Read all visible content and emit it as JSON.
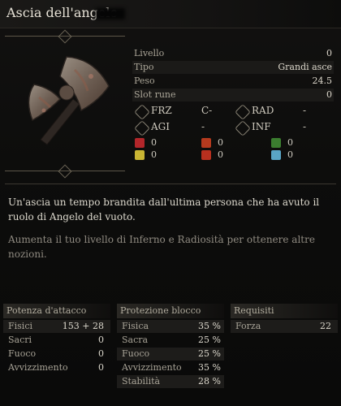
{
  "title": "Ascia dell'angelo",
  "stats": [
    {
      "label": "Livello",
      "value": "0"
    },
    {
      "label": "Tipo",
      "value": "Grandi asce"
    },
    {
      "label": "Peso",
      "value": "24.5"
    },
    {
      "label": "Slot rune",
      "value": "0"
    }
  ],
  "scaling": [
    {
      "label": "FRZ",
      "grade": "C-"
    },
    {
      "label": "RAD",
      "grade": "-"
    },
    {
      "label": "AGI",
      "grade": "-"
    },
    {
      "label": "INF",
      "grade": "-"
    }
  ],
  "buffs": [
    {
      "value": "0",
      "color": "#b3262a"
    },
    {
      "value": "0",
      "color": "#b53a1e"
    },
    {
      "value": "0",
      "color": "#3b7d2f"
    },
    {
      "value": "0",
      "color": "#c9b533"
    },
    {
      "value": "0",
      "color": "#b8301f"
    },
    {
      "value": "0",
      "color": "#5aa5c5"
    }
  ],
  "description": "Un'ascia un tempo brandita dall'ultima persona che ha avuto il ruolo di Angelo del vuoto.",
  "hint": "Aumenta il tuo livello di Inferno e Radiosità per ottenere altre nozioni.",
  "attack": {
    "heading": "Potenza d'attacco",
    "rows": [
      {
        "label": "Fisici",
        "value": "153 + 28"
      },
      {
        "label": "Sacri",
        "value": "0"
      },
      {
        "label": "Fuoco",
        "value": "0"
      },
      {
        "label": "Avvizzimento",
        "value": "0"
      }
    ]
  },
  "guard": {
    "heading": "Protezione blocco",
    "rows": [
      {
        "label": "Fisica",
        "value": "35 %"
      },
      {
        "label": "Sacra",
        "value": "25 %"
      },
      {
        "label": "Fuoco",
        "value": "25 %"
      },
      {
        "label": "Avvizzimento",
        "value": "35 %"
      },
      {
        "label": "Stabilità",
        "value": "28 %"
      }
    ]
  },
  "requirements": {
    "heading": "Requisiti",
    "rows": [
      {
        "label": "Forza",
        "value": "22"
      }
    ]
  },
  "icons": {
    "weapon": "great-axe-icon",
    "scaling": "diamond-rune-icon",
    "buffs": [
      "bleed-icon",
      "fire-icon",
      "poison-icon",
      "holy-icon",
      "flame-icon",
      "frost-icon"
    ]
  }
}
